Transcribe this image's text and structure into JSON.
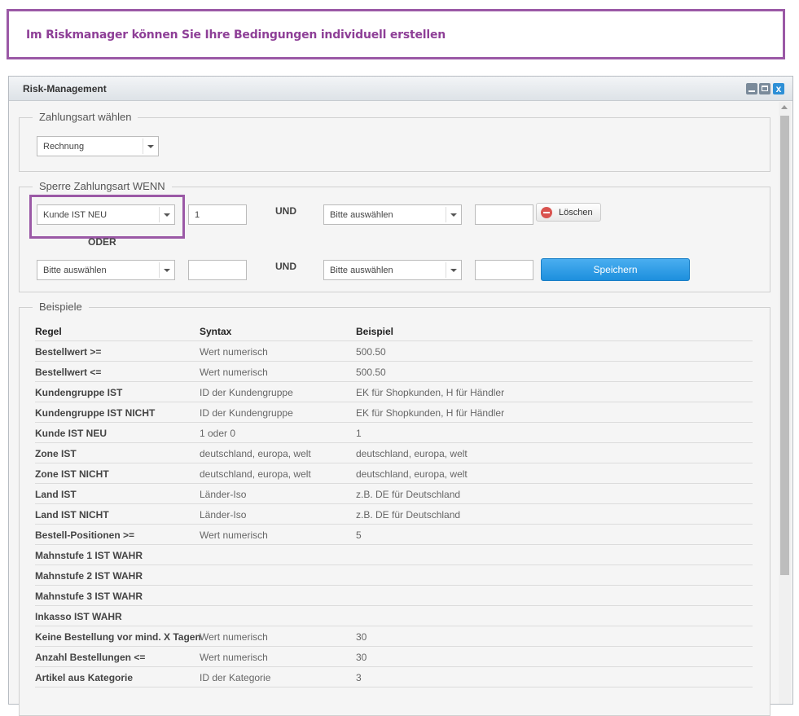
{
  "callout": {
    "text": "Im Riskmanager können Sie Ihre Bedingungen individuell erstellen"
  },
  "window": {
    "title": "Risk-Management",
    "close_glyph": "x"
  },
  "payment_section": {
    "legend": "Zahlungsart wählen",
    "selected": "Rechnung"
  },
  "condition_section": {
    "legend": "Sperre Zahlungsart WENN",
    "row1": {
      "condition1": "Kunde IST NEU",
      "value1": "1",
      "connector": "UND",
      "condition2": "Bitte auswählen",
      "value2": "",
      "delete_label": "Löschen"
    },
    "or_label": "ODER",
    "row2": {
      "condition1": "Bitte auswählen",
      "value1": "",
      "connector": "UND",
      "condition2": "Bitte auswählen",
      "value2": "",
      "save_label": "Speichern"
    }
  },
  "examples": {
    "legend": "Beispiele",
    "headers": [
      "Regel",
      "Syntax",
      "Beispiel"
    ],
    "rows": [
      [
        "Bestellwert >=",
        "Wert numerisch",
        "500.50"
      ],
      [
        "Bestellwert <=",
        "Wert numerisch",
        "500.50"
      ],
      [
        "Kundengruppe IST",
        "ID der Kundengruppe",
        "EK für Shopkunden, H für Händler"
      ],
      [
        "Kundengruppe IST NICHT",
        "ID der Kundengruppe",
        "EK für Shopkunden, H für Händler"
      ],
      [
        "Kunde IST NEU",
        "1 oder 0",
        "1"
      ],
      [
        "Zone IST",
        "deutschland, europa, welt",
        "deutschland, europa, welt"
      ],
      [
        "Zone IST NICHT",
        "deutschland, europa, welt",
        "deutschland, europa, welt"
      ],
      [
        "Land IST",
        "Länder-Iso",
        "z.B. DE für Deutschland"
      ],
      [
        "Land IST NICHT",
        "Länder-Iso",
        "z.B. DE für Deutschland"
      ],
      [
        "Bestell-Positionen >=",
        "Wert numerisch",
        "5"
      ],
      [
        "Mahnstufe 1 IST WAHR",
        "",
        ""
      ],
      [
        "Mahnstufe 2 IST WAHR",
        "",
        ""
      ],
      [
        "Mahnstufe 3 IST WAHR",
        "",
        ""
      ],
      [
        "Inkasso IST WAHR",
        "",
        ""
      ],
      [
        "Keine Bestellung vor mind. X Tagen",
        "Wert numerisch",
        "30"
      ],
      [
        "Anzahl Bestellungen <=",
        "Wert numerisch",
        "30"
      ],
      [
        "Artikel aus Kategorie",
        "ID der Kategorie",
        "3"
      ]
    ]
  }
}
